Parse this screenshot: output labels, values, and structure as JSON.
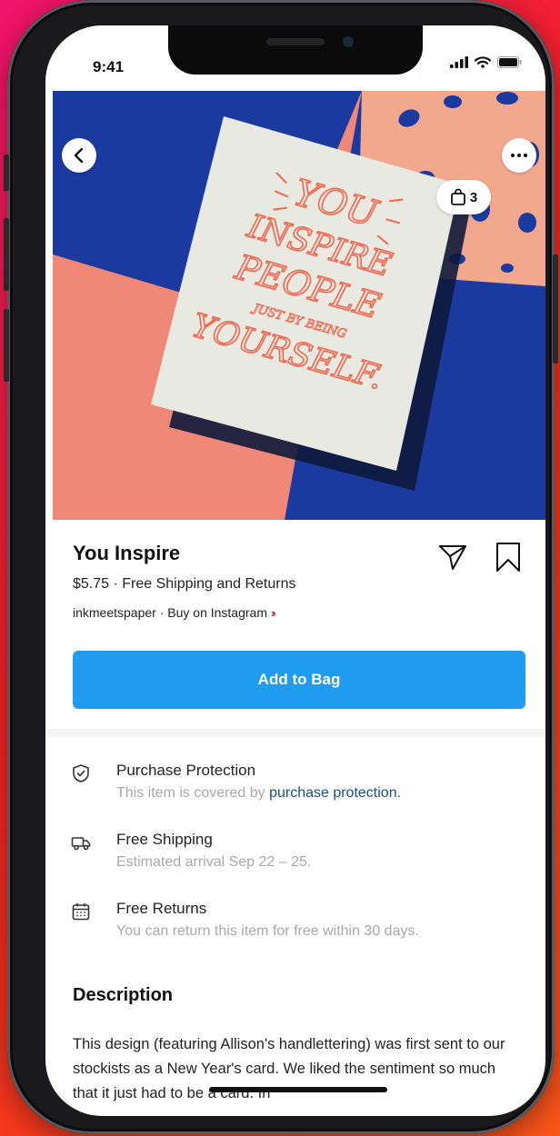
{
  "status_bar": {
    "time": "9:41"
  },
  "product_image": {
    "card_lines": [
      "YOU",
      "INSPIRE",
      "PEOPLE",
      "JUST BY BEING",
      "YOURSELF."
    ],
    "bag_count": "3",
    "image_progress": 0.1,
    "colors": {
      "coral": "#f08878",
      "navy": "#1a3aa0",
      "peach": "#f2a88c",
      "card": "#e8e9e0",
      "lettering": "#f2664f"
    }
  },
  "product": {
    "title": "You Inspire",
    "price_line": "$5.75 · Free Shipping and Returns",
    "seller_line": "inkmeetspaper · Buy on Instagram",
    "add_button": "Add to Bag"
  },
  "features": [
    {
      "icon": "shield-check-icon",
      "title": "Purchase Protection",
      "subtitle": "This item is covered by ",
      "link": "purchase protection."
    },
    {
      "icon": "truck-icon",
      "title": "Free Shipping",
      "subtitle": "Estimated arrival Sep 22 – 25."
    },
    {
      "icon": "calendar-icon",
      "title": "Free Returns",
      "subtitle": "You can return this item for free within 30 days."
    }
  ],
  "description": {
    "heading": "Description",
    "body": "This design (featuring Allison's handlettering) was first sent to our stockists as a New Year's card. We liked the sentiment so much that it just had to be a card. In"
  },
  "theme": {
    "accent": "#1f9bf0",
    "link": "#1a4c8c",
    "instagram_pink": "#e1306c"
  }
}
